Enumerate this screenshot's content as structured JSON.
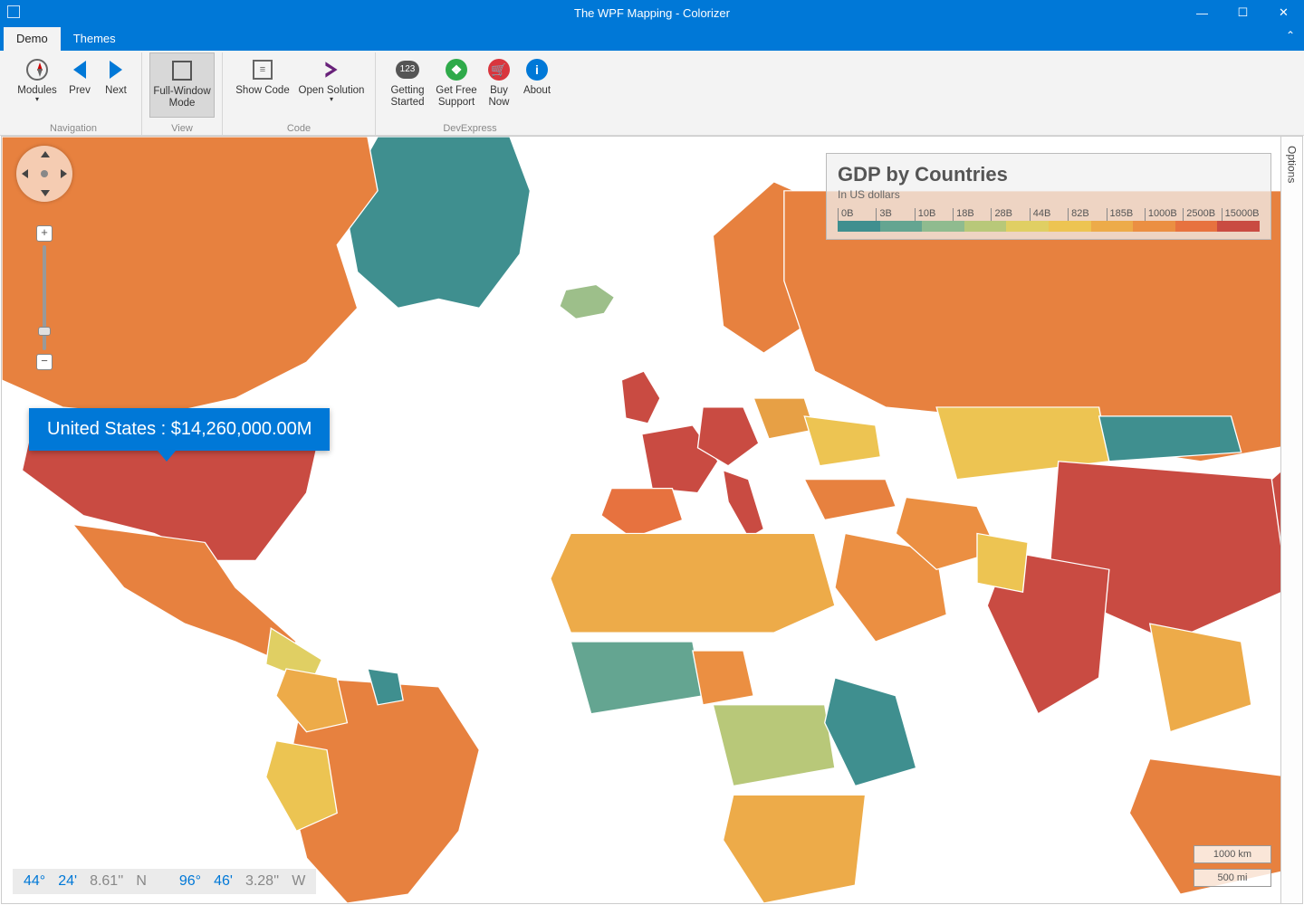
{
  "window": {
    "title": "The WPF Mapping - Colorizer"
  },
  "tabs": {
    "demo": "Demo",
    "themes": "Themes"
  },
  "ribbon": {
    "modules": "Modules",
    "prev": "Prev",
    "next": "Next",
    "full": "Full-Window Mode",
    "showcode": "Show Code",
    "opensln": "Open Solution",
    "getstart": "Getting Started",
    "getsupp": "Get Free Support",
    "buy": "Buy Now",
    "about": "About",
    "g_nav": "Navigation",
    "g_view": "View",
    "g_code": "Code",
    "g_dx": "DevExpress",
    "ico123": "123"
  },
  "options": "Options",
  "tooltip": {
    "text": "United States : $14,260,000.00M"
  },
  "legend": {
    "title": "GDP by Countries",
    "subtitle": "In US dollars",
    "stops": [
      "0B",
      "3B",
      "10B",
      "18B",
      "28B",
      "44B",
      "82B",
      "185B",
      "1000B",
      "2500B",
      "15000B"
    ],
    "colors": [
      "#3f8f8f",
      "#64a591",
      "#8fbb8f",
      "#b8c879",
      "#e0cf63",
      "#edc452",
      "#edab49",
      "#eb8f42",
      "#e7723f",
      "#c94b42"
    ]
  },
  "scale": {
    "km": "1000 km",
    "mi": "500 mi"
  },
  "coord": {
    "lat_deg": "44°",
    "lat_min": "24'",
    "lat_sec": "8.61''",
    "lat_dir": "N",
    "lon_deg": "96°",
    "lon_min": "46'",
    "lon_sec": "3.28''",
    "lon_dir": "W"
  },
  "chart_data": {
    "type": "choropleth-map",
    "title": "GDP by Countries",
    "unit": "US dollars (billions)",
    "color_scale": {
      "breaks": [
        0,
        3,
        10,
        18,
        28,
        44,
        82,
        185,
        1000,
        2500,
        15000
      ],
      "colors": [
        "#3f8f8f",
        "#64a591",
        "#8fbb8f",
        "#b8c879",
        "#e0cf63",
        "#edc452",
        "#edab49",
        "#eb8f42",
        "#e7723f",
        "#c94b42"
      ]
    },
    "highlighted": {
      "country": "United States",
      "value_million_usd": 14260000.0
    }
  }
}
